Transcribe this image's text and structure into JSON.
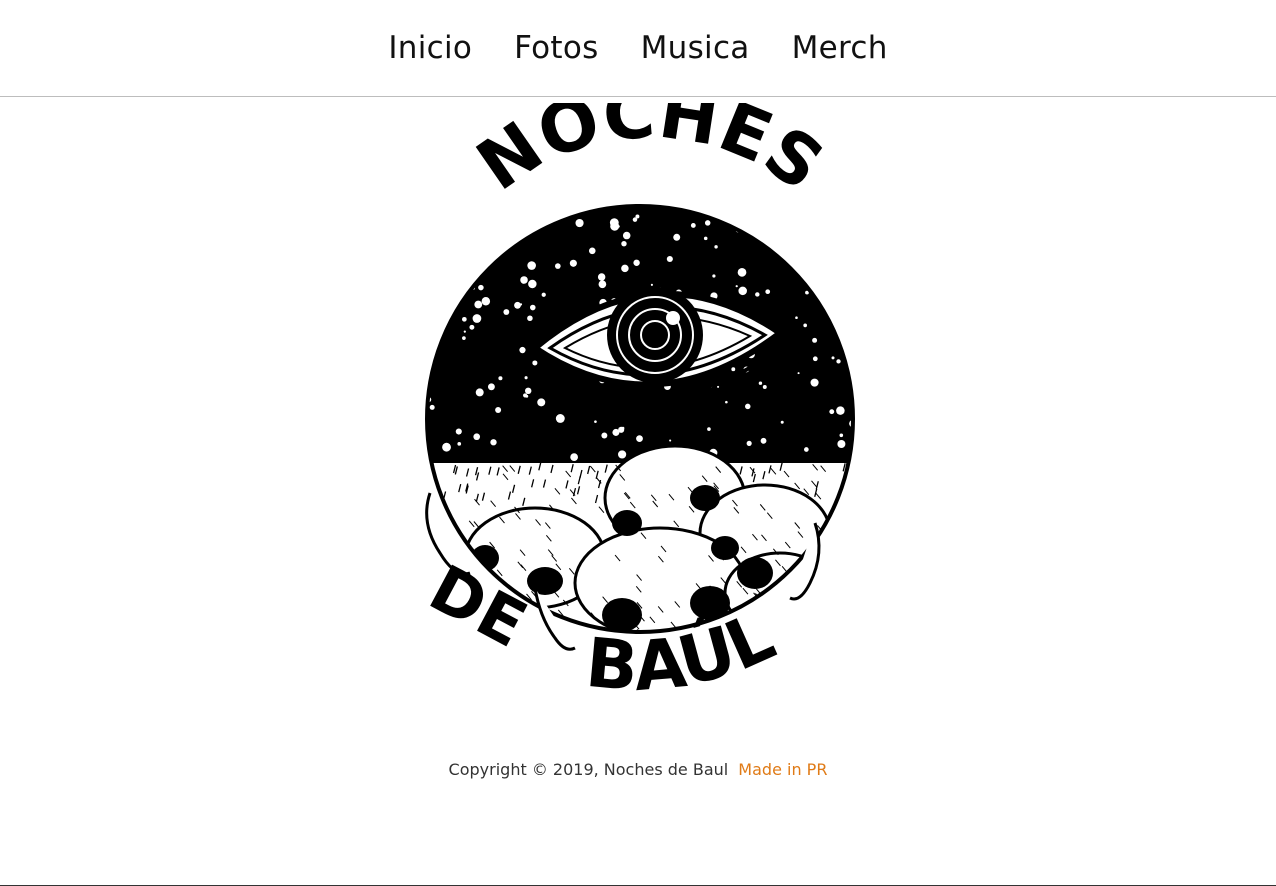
{
  "nav": {
    "items": [
      {
        "label": "Inicio"
      },
      {
        "label": "Fotos"
      },
      {
        "label": "Musica"
      },
      {
        "label": "Merch"
      }
    ]
  },
  "logo": {
    "text_top": "NOCHES",
    "text_left": "DE",
    "text_bottom": "BAÚL",
    "icon": "eye-skulls-logo"
  },
  "footer": {
    "copyright": "Copyright © 2019, Noches de Baul",
    "made_in": "Made in PR",
    "accent_color": "#e07b17"
  }
}
